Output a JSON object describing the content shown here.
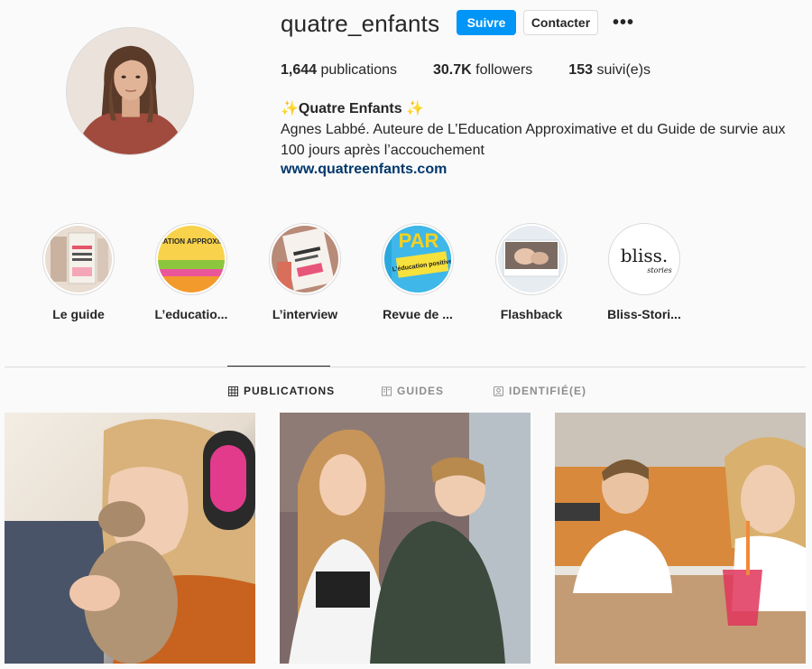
{
  "profile": {
    "username": "quatre_enfants",
    "follow_label": "Suivre",
    "contact_label": "Contacter",
    "more_label": "•••"
  },
  "stats": {
    "posts_count": "1,644",
    "posts_label": "publications",
    "followers_count": "30.7K",
    "followers_label": "followers",
    "following_count": "153",
    "following_label": "suivi(e)s"
  },
  "bio": {
    "name": "✨Quatre Enfants ✨",
    "text": "Agnes Labbé. Auteure de L’Education Approximative et du Guide de survie aux 100 jours après l’accouchement",
    "link": "www.quatreenfants.com"
  },
  "highlights": [
    {
      "label": "Le guide"
    },
    {
      "label": "L’educatio..."
    },
    {
      "label": "L’interview"
    },
    {
      "label": "Revue de ..."
    },
    {
      "label": "Flashback"
    },
    {
      "label": "Bliss-Stori..."
    }
  ],
  "highlight_text": {
    "bliss_title": "bliss.",
    "bliss_sub": "stories",
    "edu_title": "L’ÉDUCATION APPROXIMATIVE",
    "paris_text": "PAR",
    "paris_sub": "L’éducation positive"
  },
  "tabs": [
    {
      "label": "PUBLICATIONS",
      "icon": "grid-icon",
      "active": true
    },
    {
      "label": "GUIDES",
      "icon": "guide-icon",
      "active": false
    },
    {
      "label": "IDENTIFIÉ(E)",
      "icon": "tagged-icon",
      "active": false
    }
  ],
  "colors": {
    "accent": "#0095f6",
    "link": "#00376b",
    "border": "#dbdbdb",
    "background": "#fafafa"
  }
}
